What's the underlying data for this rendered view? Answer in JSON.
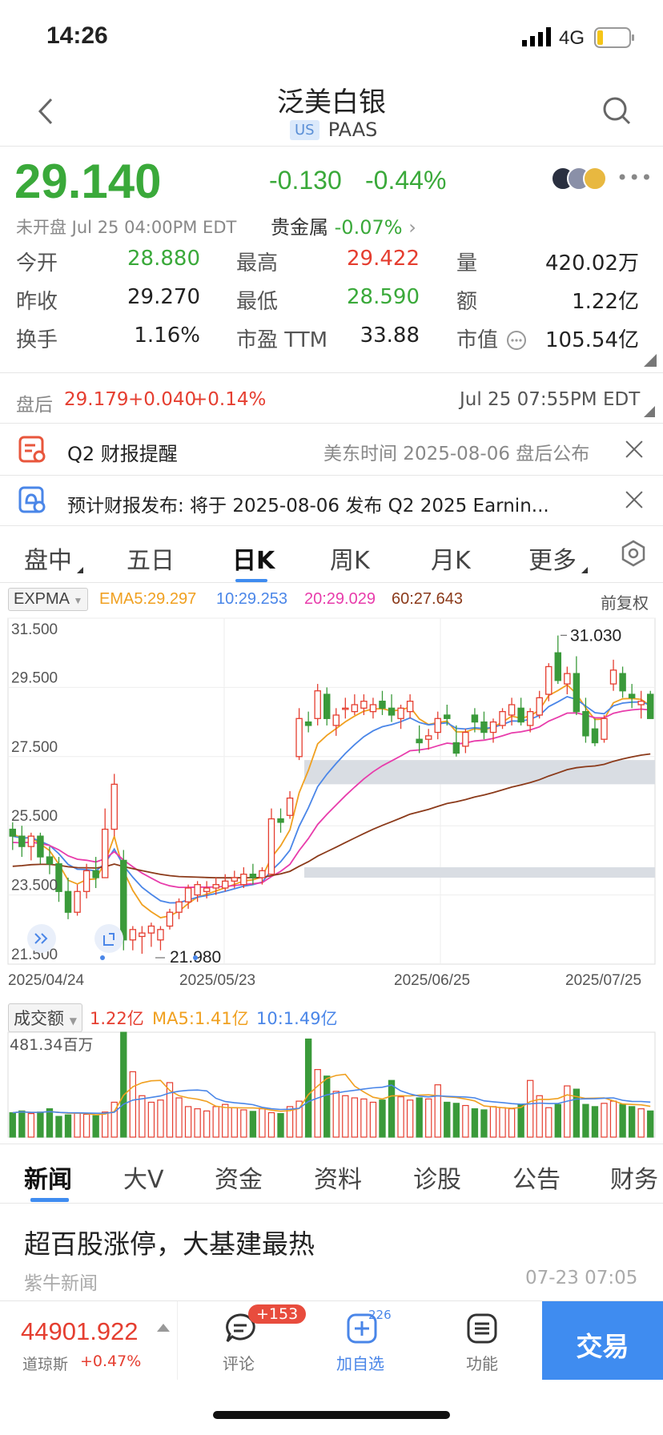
{
  "status_bar": {
    "time": "14:26",
    "network": "4G"
  },
  "nav": {
    "title": "泛美白银",
    "market_badge": "US",
    "ticker": "PAAS"
  },
  "quote": {
    "price": "29.140",
    "change": "-0.130",
    "change_pct": "-0.44%",
    "session": "未开盘 Jul 25 04:00PM EDT",
    "sector_label": "贵金属",
    "sector_change": "-0.07%"
  },
  "stats": [
    {
      "label": "今开",
      "value": "28.880",
      "color": "green"
    },
    {
      "label": "最高",
      "value": "29.422",
      "color": "red"
    },
    {
      "label": "量",
      "value": "420.02万",
      "color": "black"
    },
    {
      "label": "昨收",
      "value": "29.270",
      "color": "black"
    },
    {
      "label": "最低",
      "value": "28.590",
      "color": "green"
    },
    {
      "label": "额",
      "value": "1.22亿",
      "color": "black"
    },
    {
      "label": "换手",
      "value": "1.16%",
      "color": "black"
    },
    {
      "label": "市盈 TTM",
      "value": "33.88",
      "color": "black"
    },
    {
      "label": "市值",
      "value": "105.54亿",
      "color": "black"
    }
  ],
  "after_hours": {
    "label": "盘后",
    "price": "29.179",
    "change": "+0.040",
    "change_pct": "+0.14%",
    "time": "Jul 25 07:55PM EDT"
  },
  "notices": [
    {
      "title": "Q2 财报提醒",
      "detail": "美东时间 2025-08-06 盘后公布"
    },
    {
      "title": "预计财报发布: 将于 2025-08-06 发布 Q2 2025 Earnin..."
    }
  ],
  "chart_tabs": [
    "盘中",
    "五日",
    "日K",
    "周K",
    "月K",
    "更多"
  ],
  "chart_tabs_active": 2,
  "indicator": {
    "name": "EXPMA",
    "ema5": "EMA5:29.297",
    "ema10": "10:29.253",
    "ema20": "20:29.029",
    "ema60": "60:27.643",
    "adjust": "前复权",
    "colors": {
      "ema5": "#f0a020",
      "ema10": "#4a86e8",
      "ema20": "#e83cab",
      "ema60": "#8b3a1a"
    }
  },
  "price_axis": [
    "31.500",
    "29.500",
    "27.500",
    "25.500",
    "23.500",
    "21.500"
  ],
  "date_axis": [
    "2025/04/24",
    "2025/05/23",
    "2025/06/25",
    "2025/07/25"
  ],
  "high_label": "31.030",
  "low_label": "21.980",
  "volume_header": {
    "name": "成交额",
    "value": "1.22亿",
    "ma5": "MA5:1.41亿",
    "ma10": "10:1.49亿",
    "axis_max": "481.34百万"
  },
  "chart_data": {
    "type": "candlestick",
    "ylim": [
      21.5,
      31.5
    ],
    "x_ticks": [
      "2025/04/24",
      "2025/05/23",
      "2025/06/25",
      "2025/07/25"
    ],
    "candles": [
      [
        25.4,
        25.6,
        24.8,
        25.2
      ],
      [
        25.2,
        25.5,
        24.6,
        24.9
      ],
      [
        24.9,
        25.3,
        24.5,
        25.2
      ],
      [
        25.2,
        25.3,
        24.4,
        24.6
      ],
      [
        24.6,
        24.9,
        24.1,
        24.4
      ],
      [
        24.4,
        24.6,
        23.3,
        23.6
      ],
      [
        23.6,
        24.0,
        22.8,
        23.0
      ],
      [
        23.0,
        23.8,
        22.9,
        23.6
      ],
      [
        23.6,
        24.4,
        23.4,
        24.2
      ],
      [
        24.2,
        24.6,
        23.7,
        24.0
      ],
      [
        24.0,
        26.0,
        24.0,
        25.4
      ],
      [
        25.4,
        27.0,
        25.2,
        26.7
      ],
      [
        24.5,
        24.8,
        21.9,
        22.2
      ],
      [
        22.2,
        22.6,
        21.9,
        22.5
      ],
      [
        22.3,
        22.6,
        21.8,
        22.4
      ],
      [
        22.4,
        22.7,
        22.0,
        22.6
      ],
      [
        22.2,
        22.6,
        21.9,
        22.5
      ],
      [
        22.6,
        23.1,
        22.5,
        23.0
      ],
      [
        23.0,
        23.4,
        22.8,
        23.3
      ],
      [
        23.3,
        23.8,
        23.1,
        23.7
      ],
      [
        23.5,
        23.9,
        23.3,
        23.8
      ],
      [
        23.6,
        23.9,
        23.4,
        23.7
      ],
      [
        23.7,
        24.0,
        23.5,
        23.8
      ],
      [
        23.7,
        24.1,
        23.6,
        23.9
      ],
      [
        23.9,
        24.2,
        23.7,
        24.0
      ],
      [
        23.8,
        24.3,
        23.7,
        24.1
      ],
      [
        24.1,
        24.4,
        23.8,
        24.0
      ],
      [
        24.0,
        24.3,
        23.8,
        24.2
      ],
      [
        24.1,
        26.0,
        24.1,
        25.7
      ],
      [
        25.7,
        26.0,
        25.3,
        25.6
      ],
      [
        25.8,
        26.5,
        25.7,
        26.3
      ],
      [
        27.5,
        28.9,
        27.4,
        28.6
      ],
      [
        28.5,
        28.8,
        28.2,
        28.4
      ],
      [
        28.6,
        29.6,
        28.4,
        29.4
      ],
      [
        29.3,
        29.5,
        28.4,
        28.6
      ],
      [
        28.4,
        28.9,
        28.1,
        28.7
      ],
      [
        28.9,
        29.2,
        28.6,
        28.9
      ],
      [
        28.8,
        29.3,
        28.7,
        29.0
      ],
      [
        28.9,
        29.3,
        28.7,
        29.1
      ],
      [
        28.8,
        29.2,
        28.6,
        29.0
      ],
      [
        29.1,
        29.4,
        28.7,
        28.9
      ],
      [
        28.9,
        29.3,
        28.5,
        28.7
      ],
      [
        28.6,
        29.0,
        28.3,
        28.9
      ],
      [
        28.8,
        29.3,
        28.6,
        29.1
      ],
      [
        28.0,
        28.4,
        27.6,
        27.9
      ],
      [
        28.0,
        28.3,
        27.7,
        28.1
      ],
      [
        28.2,
        28.8,
        28.0,
        28.6
      ],
      [
        28.7,
        29.0,
        28.4,
        28.6
      ],
      [
        27.9,
        28.4,
        27.5,
        27.6
      ],
      [
        27.8,
        28.3,
        27.6,
        28.2
      ],
      [
        28.7,
        28.9,
        28.2,
        28.5
      ],
      [
        28.5,
        28.8,
        28.0,
        28.2
      ],
      [
        28.2,
        28.6,
        27.9,
        28.5
      ],
      [
        28.4,
        28.9,
        28.3,
        28.8
      ],
      [
        28.7,
        29.2,
        28.4,
        29.0
      ],
      [
        28.9,
        29.2,
        28.4,
        28.5
      ],
      [
        28.4,
        28.9,
        28.2,
        28.8
      ],
      [
        28.7,
        29.4,
        28.6,
        29.2
      ],
      [
        29.3,
        30.2,
        29.1,
        30.1
      ],
      [
        30.5,
        31.0,
        29.6,
        29.7
      ],
      [
        29.6,
        30.1,
        29.3,
        29.9
      ],
      [
        29.9,
        30.4,
        28.7,
        28.8
      ],
      [
        28.8,
        29.2,
        27.9,
        28.1
      ],
      [
        28.3,
        28.6,
        27.8,
        27.9
      ],
      [
        28.0,
        28.7,
        27.9,
        28.6
      ],
      [
        29.6,
        30.3,
        29.4,
        30.0
      ],
      [
        29.9,
        30.1,
        29.2,
        29.4
      ],
      [
        29.3,
        29.6,
        28.9,
        29.2
      ],
      [
        29.0,
        29.4,
        28.6,
        29.1
      ],
      [
        29.3,
        29.4,
        28.6,
        28.6
      ]
    ],
    "volume_ylim": [
      0,
      481.34
    ],
    "volumes": [
      112,
      120,
      108,
      115,
      130,
      95,
      102,
      110,
      105,
      98,
      115,
      160,
      481,
      300,
      190,
      160,
      170,
      250,
      180,
      140,
      130,
      120,
      140,
      150,
      135,
      125,
      118,
      130,
      112,
      108,
      140,
      165,
      450,
      310,
      280,
      210,
      190,
      180,
      175,
      160,
      170,
      260,
      185,
      170,
      180,
      175,
      240,
      160,
      155,
      145,
      130,
      125,
      140,
      135,
      130,
      150,
      260,
      190,
      135,
      150,
      235,
      220,
      150,
      140,
      155,
      165,
      150,
      140,
      130,
      120
    ]
  },
  "volume_colors": {
    "up": "#e53e30",
    "down": "#3a9a3a",
    "ma5": "#f0a020",
    "ma10": "#4a86e8"
  },
  "zones": [
    {
      "from": 26.7,
      "to": 27.4
    },
    {
      "from": 24.0,
      "to": 24.3
    }
  ],
  "bottom_tabs": [
    "新闻",
    "大V",
    "资金",
    "资料",
    "诊股",
    "公告",
    "财务"
  ],
  "bottom_tabs_active": 0,
  "news": {
    "title": "超百股涨停，大基建最热",
    "source": "紫牛新闻",
    "time": "07-23 07:05"
  },
  "footer": {
    "index_value": "44901.922",
    "index_name": "道琼斯",
    "index_change": "+0.47%",
    "comment_label": "评论",
    "comment_badge": "+153",
    "watch_label": "加自选",
    "watch_count": "226",
    "func_label": "功能",
    "trade_label": "交易"
  }
}
